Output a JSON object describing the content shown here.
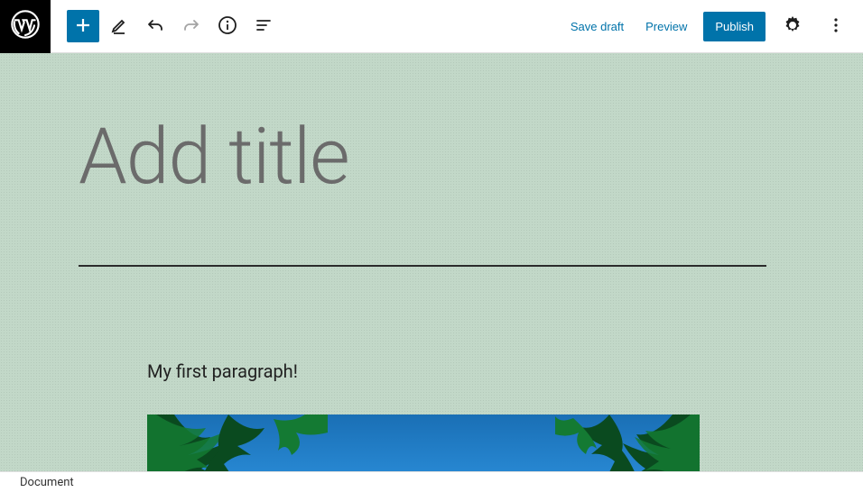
{
  "toolbar": {
    "save_draft": "Save draft",
    "preview": "Preview",
    "publish": "Publish"
  },
  "editor": {
    "title_placeholder": "Add title",
    "paragraph_text": "My first paragraph!"
  },
  "footer": {
    "breadcrumb": "Document"
  },
  "icons": {
    "wordpress": "wordpress-logo",
    "add": "plus",
    "edit": "pencil",
    "undo": "undo",
    "redo": "redo",
    "info": "info",
    "outline": "outline",
    "settings": "gear",
    "more": "dots-vertical"
  }
}
